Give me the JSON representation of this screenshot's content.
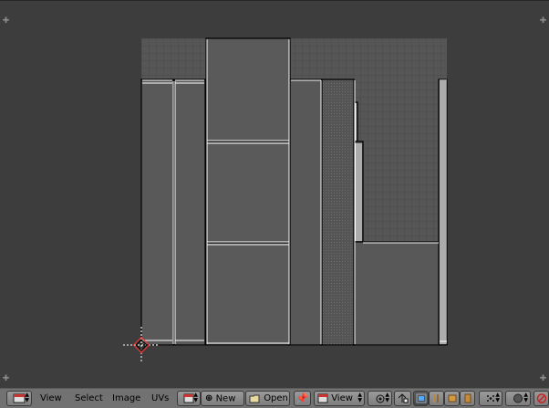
{
  "header": {
    "menu_view": "View",
    "menu_select": "Select",
    "menu_image": "Image",
    "menu_uvs": "UVs",
    "new_label": "New",
    "open_label": "Open",
    "view_mode_label": "View"
  },
  "icons": {
    "editor_type": "image-editor-icon",
    "image_browse": "image-browse-icon",
    "new": "plus-icon",
    "open": "folder-icon",
    "pin": "pin-icon",
    "view_mode": "image-icon",
    "pivot": "pivot-icon",
    "sync": "sync-selection-icon",
    "select_vertex": "vertex-select-icon",
    "select_edge": "edge-select-icon",
    "select_face": "face-select-icon",
    "select_island": "island-select-icon",
    "snap": "snap-icon",
    "proportional": "proportional-icon",
    "render": "render-icon"
  },
  "colors": {
    "background": "#3d3d3d",
    "grid": "#4f4f4f",
    "uv_edge": "#000000",
    "uv_edge_highlight": "#ffffff",
    "cursor": "#ff3030",
    "header": "#727272"
  }
}
